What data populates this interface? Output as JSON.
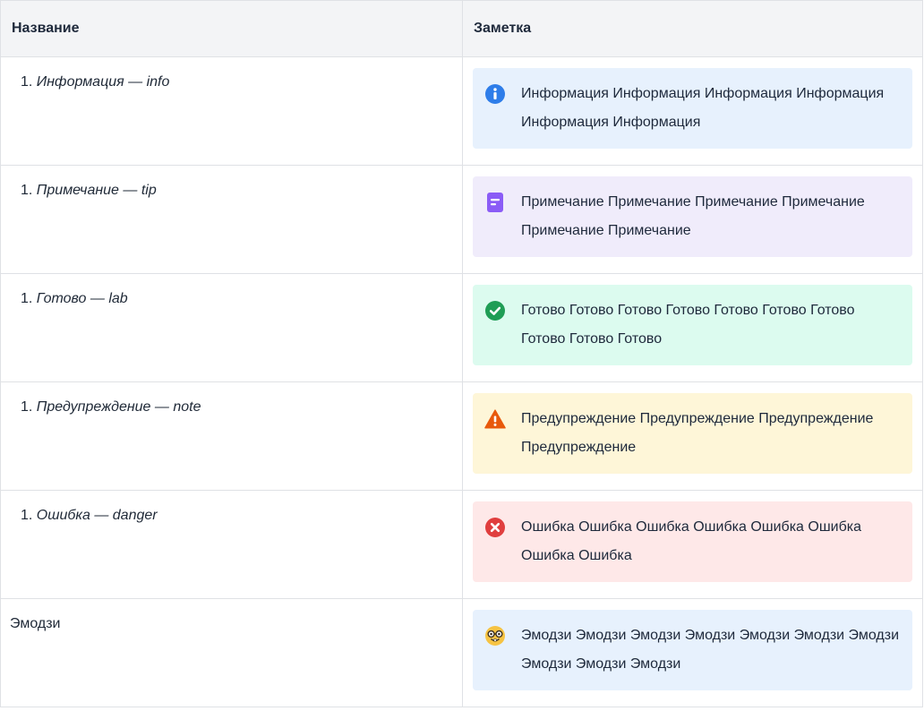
{
  "table": {
    "headers": {
      "name": "Название",
      "note": "Заметка"
    },
    "rows": [
      {
        "number": "1.",
        "name": "Информация — info",
        "note_text": "Информация Информация Информация Информация Информация Информация",
        "icon": "info-icon",
        "color": "#e7f1fd",
        "icon_color": "#2e7de9"
      },
      {
        "number": "1.",
        "name": "Примечание — tip",
        "note_text": "Примечание Примечание Примечание Примечание Примечание Примечание",
        "icon": "note-page-icon",
        "color": "#f0ecfb",
        "icon_color": "#8b5cf6"
      },
      {
        "number": "1.",
        "name": "Готово — lab",
        "note_text": "Готово Готово Готово Готово Готово Готово Готово Готово Готово Готово",
        "icon": "check-circle-icon",
        "color": "#dcfbef",
        "icon_color": "#1f9d55"
      },
      {
        "number": "1.",
        "name": "Предупреждение — note",
        "note_text": "Предупреждение Предупреждение Предупреждение Предупреждение",
        "icon": "warning-triangle-icon",
        "color": "#fef6d8",
        "icon_color": "#e8590c"
      },
      {
        "number": "1.",
        "name": "Ошибка — danger",
        "note_text": "Ошибка Ошибка Ошибка Ошибка Ошибка Ошибка Ошибка Ошибка",
        "icon": "error-circle-icon",
        "color": "#fee8e8",
        "icon_color": "#e03e3e"
      },
      {
        "number": "",
        "name": "Эмодзи",
        "note_text": "Эмодзи Эмодзи Эмодзи Эмодзи Эмодзи Эмодзи Эмодзи Эмодзи Эмодзи Эмодзи",
        "icon": "nerd-face-emoji-icon",
        "color": "#e7f1fd",
        "icon_color": "#f6c343"
      }
    ]
  }
}
